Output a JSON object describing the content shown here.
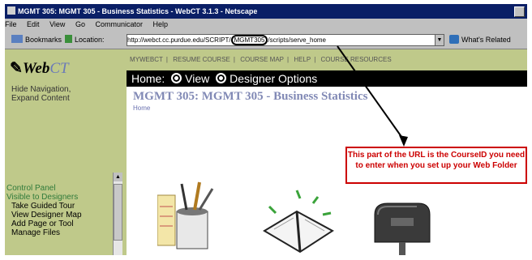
{
  "window": {
    "title": "MGMT 305: MGMT 305 - Business Statistics - WebCT 3.1.3 - Netscape"
  },
  "menu": {
    "items": [
      "File",
      "Edit",
      "View",
      "Go",
      "Communicator",
      "Help"
    ]
  },
  "locbar": {
    "bookmarks": "Bookmarks",
    "location_label": "Location:",
    "url_prefix": "http://webct.cc.purdue.edu/SCRIPT/",
    "url_highlight": "MGMT305",
    "url_suffix": "/scripts/serve_home",
    "whats_related": "What's Related"
  },
  "left": {
    "logo_web": "Web",
    "logo_ct": "CT",
    "hide_nav": "Hide Navigation,",
    "expand": "Expand Content",
    "control_panel": "Control Panel",
    "visible": "Visible to Designers",
    "tools": [
      "Take Guided Tour",
      "View Designer Map",
      "Add Page or Tool",
      "Manage Files"
    ]
  },
  "topnav": {
    "items": [
      "MYWEBCT",
      "RESUME COURSE",
      "COURSE MAP",
      "HELP",
      "COURSE RESOURCES"
    ]
  },
  "modebar": {
    "home": "Home:",
    "view": "View",
    "designer": "Designer Options"
  },
  "page": {
    "title": "MGMT 305: MGMT 305 - Business Statistics",
    "home_link": "Home"
  },
  "callout": {
    "text": "This part of the URL is the CourseID you need to enter when you set up your Web Folder"
  },
  "colors": {
    "titlebar": "#0a1f66",
    "nav_bg": "#bfc98a",
    "callout_red": "#cc0000",
    "title_blue": "#8189b5"
  }
}
